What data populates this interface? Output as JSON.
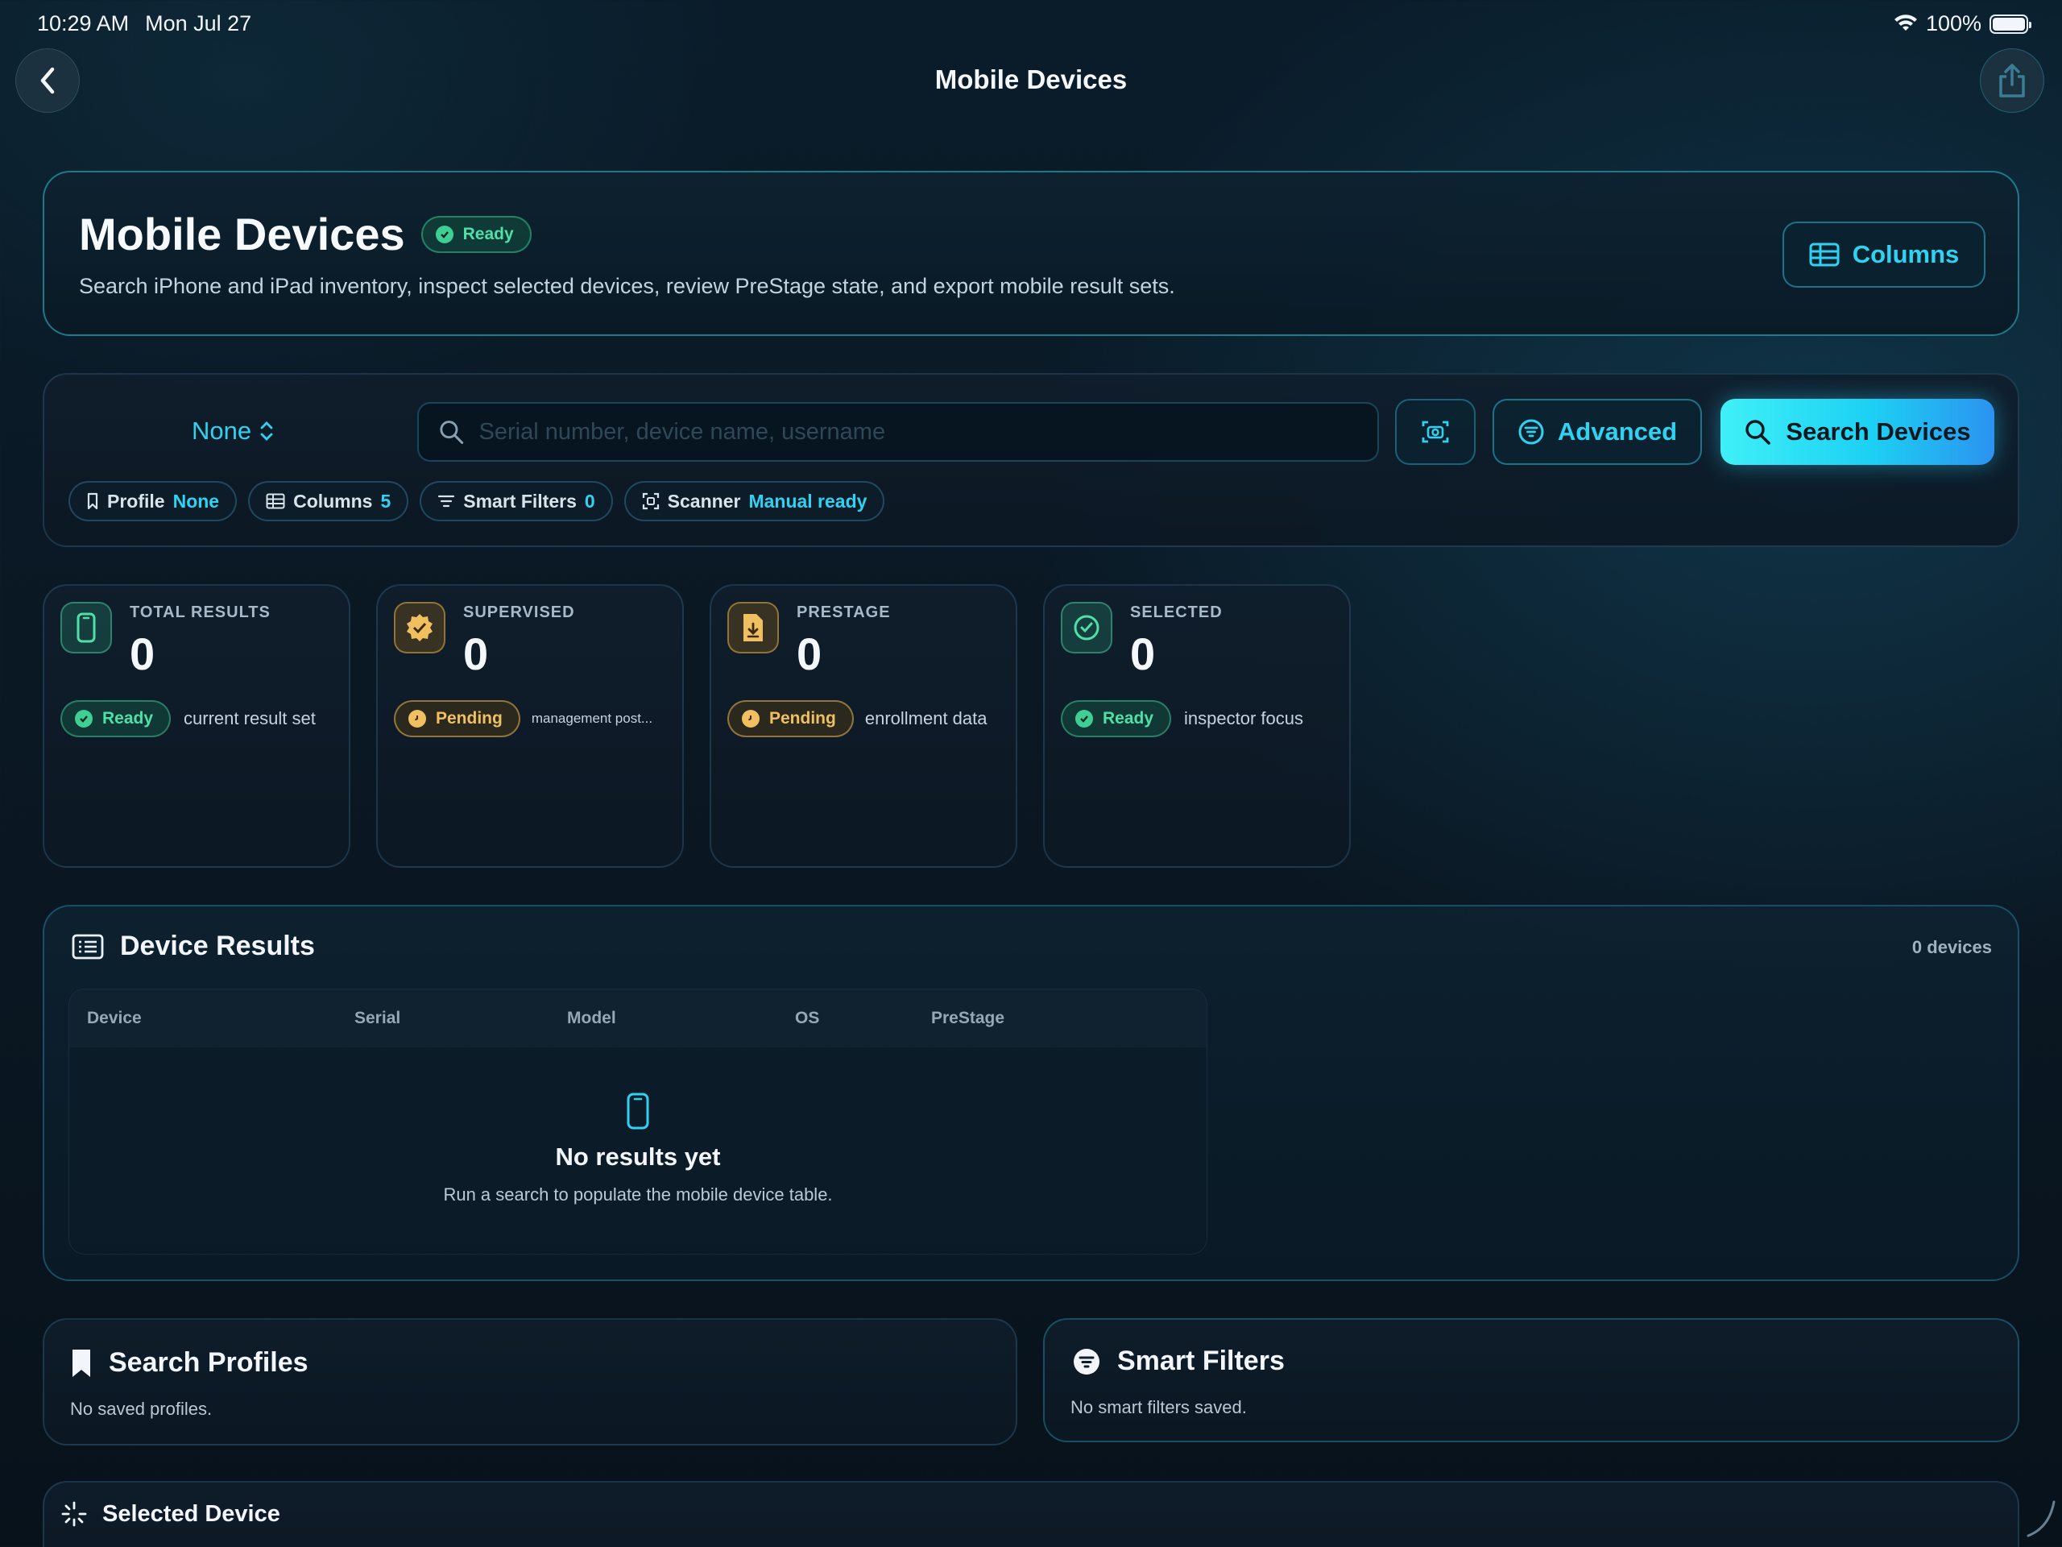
{
  "status_bar": {
    "time": "10:29 AM",
    "date": "Mon Jul 27",
    "battery": "100%"
  },
  "nav": {
    "title": "Mobile Devices"
  },
  "hero": {
    "title": "Mobile Devices",
    "status": "Ready",
    "subtitle": "Search iPhone and iPad inventory, inspect selected devices, review PreStage state, and export mobile result sets.",
    "columns_button": "Columns"
  },
  "search": {
    "profile_select": "None",
    "placeholder": "Serial number, device name, username",
    "advanced_button": "Advanced",
    "search_button": "Search Devices",
    "chips": [
      {
        "label": "Profile",
        "value": "None"
      },
      {
        "label": "Columns",
        "value": "5"
      },
      {
        "label": "Smart Filters",
        "value": "0"
      },
      {
        "label": "Scanner",
        "value": "Manual ready"
      }
    ]
  },
  "stats": [
    {
      "label": "TOTAL RESULTS",
      "value": "0",
      "status": "Ready",
      "note": "current result set"
    },
    {
      "label": "SUPERVISED",
      "value": "0",
      "status": "Pending",
      "note": "management post..."
    },
    {
      "label": "PRESTAGE",
      "value": "0",
      "status": "Pending",
      "note": "enrollment data"
    },
    {
      "label": "SELECTED",
      "value": "0",
      "status": "Ready",
      "note": "inspector focus"
    }
  ],
  "results": {
    "title": "Device Results",
    "count": "0 devices",
    "columns": [
      "Device",
      "Serial",
      "Model",
      "OS",
      "PreStage"
    ],
    "empty_title": "No results yet",
    "empty_sub": "Run a search to populate the mobile device table."
  },
  "profiles": {
    "title": "Search Profiles",
    "empty": "No saved profiles."
  },
  "smart_filters": {
    "title": "Smart Filters",
    "empty": "No smart filters saved."
  },
  "selected_device": {
    "title": "Selected Device"
  },
  "colors": {
    "accent": "#2fd2f0",
    "ready": "#4fe0a8",
    "pending": "#f0c060",
    "background": "#0a1722"
  }
}
